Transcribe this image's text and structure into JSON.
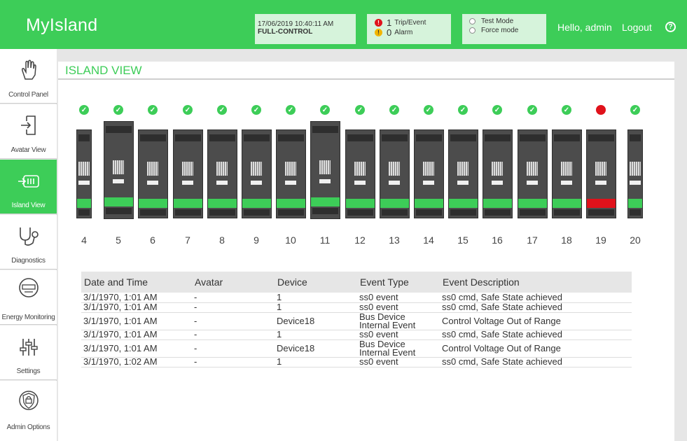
{
  "header": {
    "app_title": "MyIsland",
    "datetime": "17/06/2019 10:40:11 AM",
    "control_mode": "FULL-CONTROL",
    "trip_count": "1",
    "trip_label": "Trip/Event",
    "alarm_count": "0",
    "alarm_label": "Alarm",
    "test_mode_label": "Test Mode",
    "force_mode_label": "Force mode",
    "greeting": "Hello, admin",
    "logout_label": "Logout"
  },
  "sidebar": {
    "items": [
      {
        "label": "Control Panel",
        "icon": "hand-touch-icon"
      },
      {
        "label": "Avatar View",
        "icon": "login-arrow-icon"
      },
      {
        "label": "Island View",
        "icon": "island-module-icon"
      },
      {
        "label": "Diagnostics",
        "icon": "stethoscope-icon"
      },
      {
        "label": "Energy Monitoring",
        "icon": "energy-meter-icon"
      },
      {
        "label": "Settings",
        "icon": "sliders-icon"
      },
      {
        "label": "Admin Options",
        "icon": "shield-lock-icon"
      }
    ],
    "active": "Island View"
  },
  "main": {
    "section_title": "ISLAND VIEW"
  },
  "island": {
    "slots": [
      "4",
      "5",
      "6",
      "7",
      "8",
      "9",
      "10",
      "11",
      "12",
      "13",
      "14",
      "15",
      "16",
      "17",
      "18",
      "19",
      "20"
    ],
    "status": [
      "ok",
      "ok",
      "ok",
      "ok",
      "ok",
      "ok",
      "ok",
      "ok",
      "ok",
      "ok",
      "ok",
      "ok",
      "ok",
      "ok",
      "ok",
      "error",
      "ok"
    ],
    "colors": {
      "ok": "#3dcd58",
      "error": "#e0121b",
      "brand": "#3dcd58"
    }
  },
  "events": {
    "headers": [
      "Date and Time",
      "Avatar",
      "Device",
      "Event Type",
      "Event Description"
    ],
    "rows": [
      [
        "3/1/1970, 1:01 AM",
        "-",
        "1",
        "ss0 event",
        "ss0 cmd, Safe State achieved"
      ],
      [
        "3/1/1970, 1:01 AM",
        "-",
        "1",
        "ss0 event",
        "ss0 cmd, Safe State achieved"
      ],
      [
        "3/1/1970, 1:01 AM",
        "-",
        "Device18",
        "Bus Device Internal Event",
        "Control Voltage Out of Range"
      ],
      [
        "3/1/1970, 1:01 AM",
        "-",
        "1",
        "ss0 event",
        "ss0 cmd, Safe State achieved"
      ],
      [
        "3/1/1970, 1:01 AM",
        "-",
        "Device18",
        "Bus Device Internal Event",
        "Control Voltage Out of Range"
      ],
      [
        "3/1/1970, 1:02 AM",
        "-",
        "1",
        "ss0 event",
        "ss0 cmd, Safe State achieved"
      ]
    ]
  }
}
